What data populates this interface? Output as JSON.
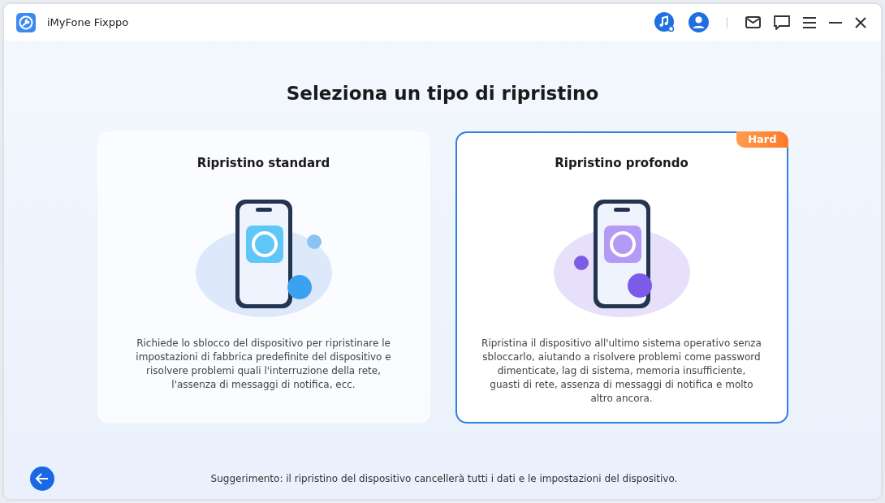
{
  "window": {
    "title": "iMyFone Fixppo"
  },
  "heading": "Seleziona un tipo di ripristino",
  "cards": [
    {
      "kind": "standard",
      "title": "Ripristino standard",
      "description": "Richiede lo sblocco del dispositivo per ripristinare le impostazioni di fabbrica predefinite del dispositivo e risolvere problemi quali l'interruzione della rete, l'assenza di messaggi di notifica, ecc.",
      "selected": false
    },
    {
      "kind": "deep",
      "title": "Ripristino profondo",
      "badge": "Hard",
      "description": "Ripristina il dispositivo all'ultimo sistema operativo senza sbloccarlo, aiutando a risolvere problemi come password dimenticate, lag di sistema, memoria insufficiente, guasti di rete, assenza di messaggi di notifica e molto altro ancora.",
      "selected": true
    }
  ],
  "footer": {
    "hint": "Suggerimento: il ripristino del dispositivo cancellerà tutti i dati e le impostazioni del dispositivo."
  }
}
